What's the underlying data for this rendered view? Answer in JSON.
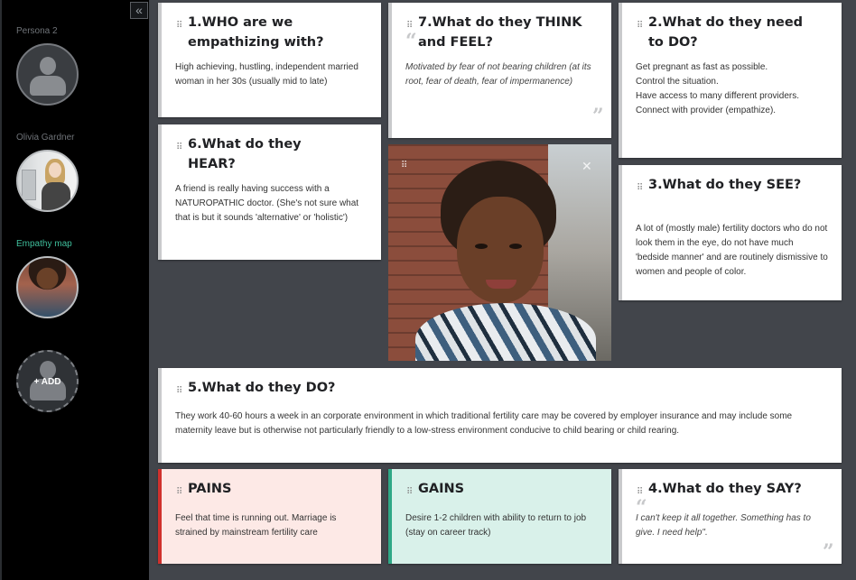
{
  "sidebar": {
    "collapse_icon": "«",
    "personas": [
      {
        "label": "Persona 2"
      },
      {
        "label": "Olivia Gardner"
      },
      {
        "label": "Empathy map"
      }
    ],
    "add_label": "+ ADD"
  },
  "cards": {
    "who": {
      "title_line1": "1.WHO are we",
      "title_line2": "empathizing with?",
      "body": "High achieving, hustling, independent married woman in her 30s (usually mid to late)"
    },
    "think": {
      "title_line1": "7.What do they THINK",
      "title_line2": "and FEEL?",
      "body": "Motivated by fear of  not bearing children (at its root, fear of death, fear of impermanence)"
    },
    "need": {
      "title_line1": "2.What do they need",
      "title_line2": "to DO?",
      "lines": [
        "Get pregnant as fast as possible.",
        "Control the situation.",
        "Have access to many different providers.",
        "Connect with provider (empathize)."
      ]
    },
    "hear": {
      "title_line1": "6.What do they",
      "title_line2": "HEAR?",
      "body": "A friend is really having success with a NATUROPATHIC doctor. (She's not sure what that is but it sounds 'alternative' or 'holistic')"
    },
    "see": {
      "title": "3.What do they SEE?",
      "body": "A lot of (mostly male) fertility doctors who do not look them in the eye, do not have much 'bedside manner' and are routinely dismissive to women and people of color."
    },
    "do": {
      "title": "5.What do they DO?",
      "body": "They work 40-60 hours a week in an corporate environment in which traditional fertility care may be covered by employer insurance and may include some maternity leave but is otherwise not particularly friendly to a low-stress environment conducive to child bearing or child rearing."
    },
    "pains": {
      "title": "PAINS",
      "body": "Feel that time is running out. Marriage is strained by mainstream fertility care"
    },
    "gains": {
      "title": "GAINS",
      "body": "Desire 1-2 children with ability to return to job (stay on career track)"
    },
    "say": {
      "title": "4.What do they SAY?",
      "body": "I can't keep it all together. Something has to give. I need help\"."
    }
  },
  "icons": {
    "drag": "⠿",
    "close": "✕",
    "quote_open": "“",
    "quote_close": "”"
  },
  "colors": {
    "accent_green": "#3fbf9c",
    "pains_accent": "#d0312d",
    "gains_accent": "#2fa886"
  }
}
